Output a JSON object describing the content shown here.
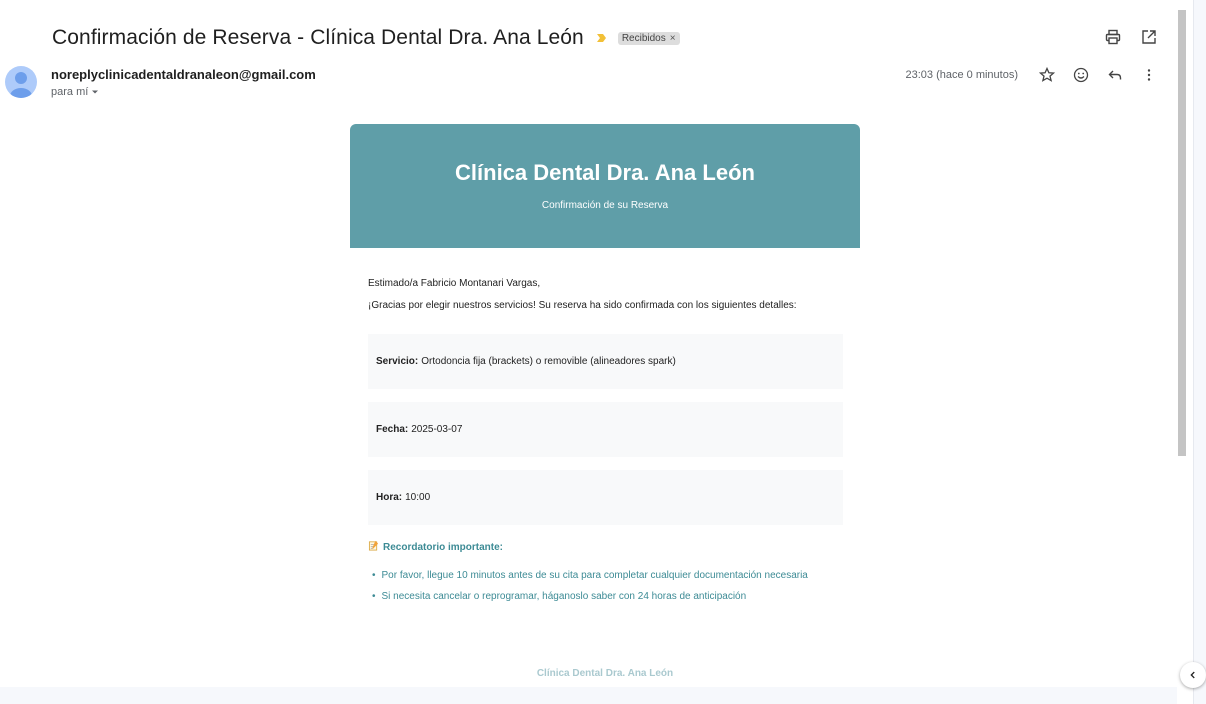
{
  "subject": "Confirmación de Reserva - Clínica Dental Dra. Ana León",
  "label": "Recibidos",
  "label_remove": "×",
  "sender": "noreplyclinicadentaldranaleon@gmail.com",
  "to_line": "para mí",
  "timestamp": "23:03 (hace 0 minutos)",
  "icons": [
    "print-icon",
    "open-in-new-window-icon",
    "star-icon",
    "emoji-icon",
    "reply-icon",
    "more-vert-icon",
    "chevron-left-icon"
  ],
  "colors": {
    "banner": "#5f9ea8",
    "accent_text": "#3d8b95",
    "importance": "#f2c037"
  },
  "email": {
    "header_title": "Clínica Dental Dra. Ana León",
    "header_subtitle": "Confirmación de su Reserva",
    "greeting": "Estimado/a Fabricio Montanari Vargas,",
    "intro": "¡Gracias por elegir nuestros servicios! Su reserva ha sido confirmada con los siguientes detalles:",
    "details": [
      {
        "label": "Servicio:",
        "value": "Ortodoncia fija (brackets) o removible (alineadores spark)"
      },
      {
        "label": "Fecha:",
        "value": "2025-03-07"
      },
      {
        "label": "Hora:",
        "value": "10:00"
      }
    ],
    "reminder_title": "Recordatorio importante:",
    "reminders": [
      "Por favor, llegue 10 minutos antes de su cita para completar cualquier documentación necesaria",
      "Si necesita cancelar o reprogramar, háganoslo saber con 24 horas de anticipación"
    ],
    "footer": "Clínica Dental Dra. Ana León"
  }
}
